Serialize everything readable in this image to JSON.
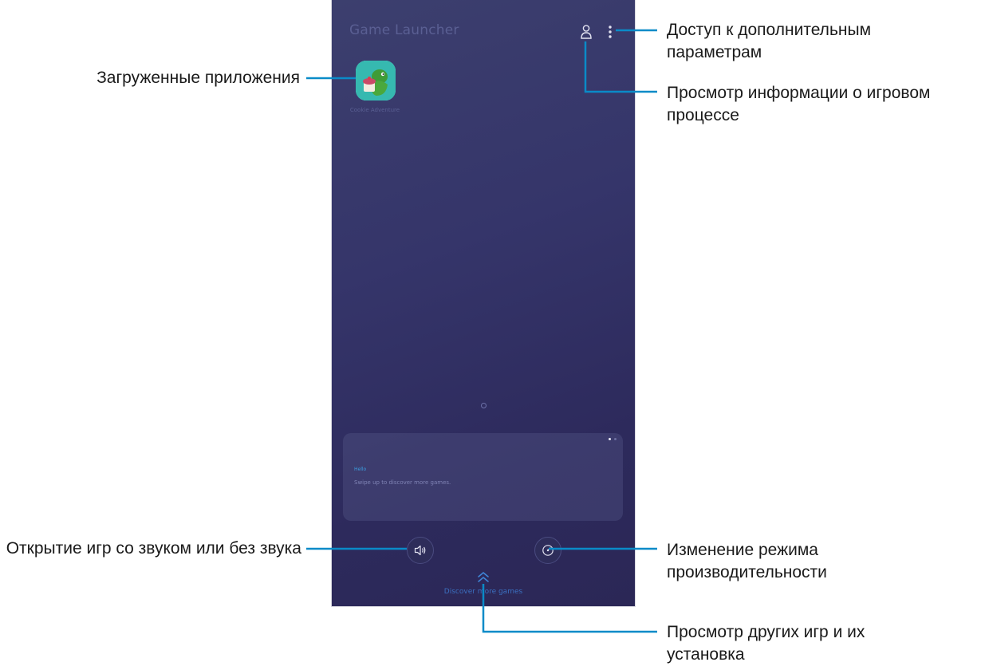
{
  "app": {
    "title": "Game Launcher",
    "installed_app_name": "Cookie Adventure",
    "card_title": "Hello",
    "card_text": "Swipe up to discover more games.",
    "discover_label": "Discover more games"
  },
  "callouts": {
    "more_options": "Доступ к дополнительным параметрам",
    "profile": "Просмотр информации о игровом процессе",
    "installed_apps": "Загруженные приложения",
    "sound": "Открытие игр со звуком или без звука",
    "performance": "Изменение режима производительности",
    "discover": "Просмотр других игр и их установка"
  },
  "icons": {
    "profile": "person-icon",
    "more": "vertical-dots-icon",
    "sound": "speaker-icon",
    "performance": "gauge-icon",
    "swipe_up": "double-chevron-up-icon"
  },
  "colors": {
    "callout_line": "#0a8bc8",
    "screen_background": "#32305f"
  }
}
